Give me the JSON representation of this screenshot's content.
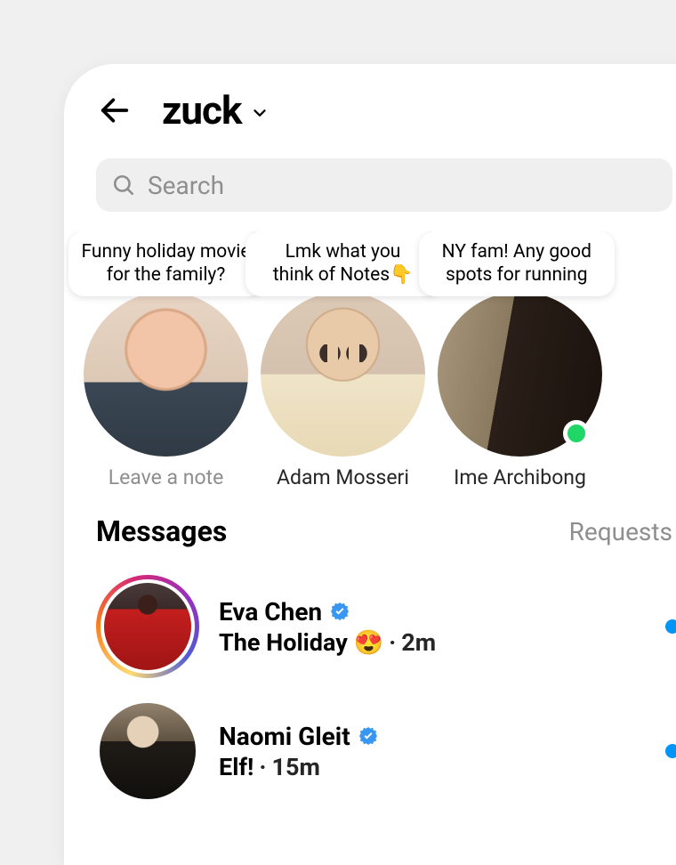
{
  "header": {
    "username": "zuck"
  },
  "search": {
    "placeholder": "Search"
  },
  "notes": [
    {
      "bubble_line1": "Funny holiday movie",
      "bubble_line2": "for the family?",
      "name": "Leave a note",
      "muted": true,
      "online": false
    },
    {
      "bubble_line1": "Lmk what you",
      "bubble_line2": "think of Notes👇",
      "name": "Adam Mosseri",
      "muted": false,
      "online": false
    },
    {
      "bubble_line1": "NY fam! Any good",
      "bubble_line2": "spots for running",
      "name": "Ime Archibong",
      "muted": false,
      "online": true
    }
  ],
  "sections": {
    "messages_title": "Messages",
    "requests_title": "Requests"
  },
  "messages": [
    {
      "name": "Eva Chen",
      "verified": true,
      "preview": "The Holiday 😍",
      "time_sep": " · ",
      "time": "2m",
      "unread": true,
      "story_ring": true
    },
    {
      "name": "Naomi Gleit",
      "verified": true,
      "preview": "Elf!",
      "time_sep": " · ",
      "time": "15m",
      "unread": true,
      "story_ring": false
    }
  ]
}
